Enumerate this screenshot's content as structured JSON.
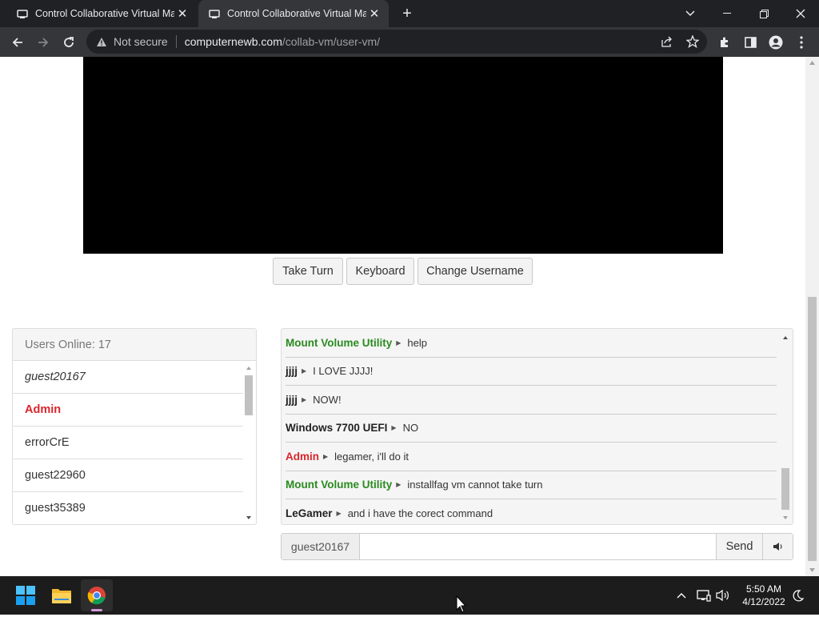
{
  "browser": {
    "tabs": [
      {
        "title": "Control Collaborative Virtual Mac",
        "active": false
      },
      {
        "title": "Control Collaborative Virtual Mac",
        "active": true
      }
    ],
    "new_tab_icon": "plus-icon",
    "security_label": "Not secure",
    "url_host": "computernewb.com",
    "url_path": "/collab-vm/user-vm/"
  },
  "vm_controls": {
    "take_turn": "Take Turn",
    "keyboard": "Keyboard",
    "change_username": "Change Username"
  },
  "users": {
    "header": "Users Online: 17",
    "list": [
      {
        "name": "guest20167",
        "style": "italic"
      },
      {
        "name": "Admin",
        "style": "admin"
      },
      {
        "name": "errorCrE",
        "style": "normal"
      },
      {
        "name": "guest22960",
        "style": "normal"
      },
      {
        "name": "guest35389",
        "style": "normal"
      }
    ]
  },
  "chat": {
    "messages": [
      {
        "nick": "Mount Volume Utility",
        "color": "#2a8a1f",
        "text": "help"
      },
      {
        "nick": "jjjj",
        "color": "#222222",
        "text": "I LOVE JJJJ!"
      },
      {
        "nick": "jjjj",
        "color": "#222222",
        "text": "NOW!"
      },
      {
        "nick": "Windows 7700 UEFI",
        "color": "#222222",
        "text": "NO"
      },
      {
        "nick": "Admin",
        "color": "#d9262c",
        "text": "legamer, i'll do it"
      },
      {
        "nick": "Mount Volume Utility",
        "color": "#2a8a1f",
        "text": "installfag vm cannot take turn"
      },
      {
        "nick": "LeGamer",
        "color": "#222222",
        "text": "and i have the corect command"
      }
    ],
    "input_username": "guest20167",
    "input_value": "",
    "send_label": "Send"
  },
  "taskbar": {
    "time": "5:50 AM",
    "date": "4/12/2022"
  },
  "colors": {
    "admin": "#d9262c",
    "moderator_green": "#2a8a1f",
    "chrome_dark": "#202124"
  }
}
